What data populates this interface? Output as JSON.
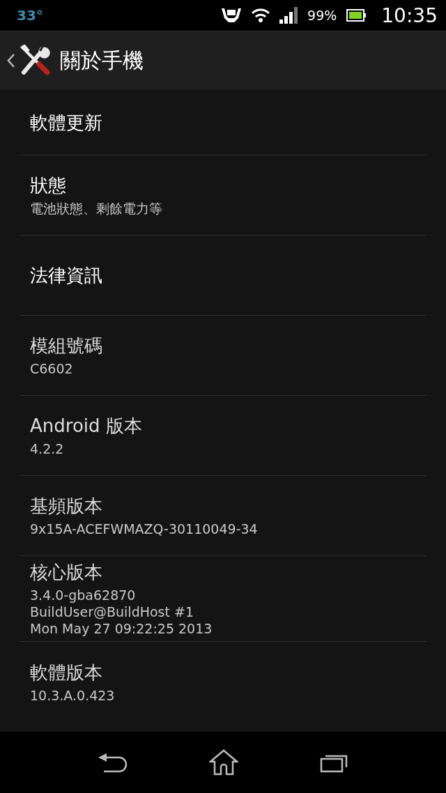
{
  "status_bar": {
    "temperature": "33°",
    "battery": "99%",
    "time": "10:35"
  },
  "action_bar": {
    "title": "關於手機"
  },
  "items": [
    {
      "kind": "action",
      "title": "軟體更新"
    },
    {
      "kind": "action",
      "title": "狀態",
      "summary": "電池狀態、剩餘電力等"
    },
    {
      "kind": "action",
      "title": "法律資訊"
    },
    {
      "kind": "info",
      "title": "模組號碼",
      "summary": "C6602"
    },
    {
      "kind": "info",
      "title": "Android 版本",
      "summary": "4.2.2"
    },
    {
      "kind": "info",
      "title": "基頻版本",
      "summary": "9x15A-ACEFWMAZQ-30110049-34"
    },
    {
      "kind": "info",
      "title": "核心版本",
      "summary": "3.4.0-gba62870\nBuildUser@BuildHost #1\nMon May 27 09:22:25 2013"
    },
    {
      "kind": "info",
      "title": "軟體版本",
      "summary": "10.3.A.0.423"
    }
  ]
}
